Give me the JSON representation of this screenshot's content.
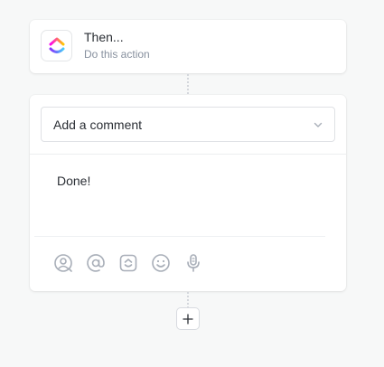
{
  "trigger": {
    "title": "Then...",
    "subtitle": "Do this action",
    "logo_icon": "clickup-logo-icon"
  },
  "action": {
    "select_value": "Add a comment",
    "comment_text": "Done!",
    "toolbar_icons": [
      "assign-icon",
      "mention-icon",
      "emoji-box-icon",
      "smiley-icon",
      "microphone-icon"
    ]
  },
  "add_step_icon": "plus-icon",
  "colors": {
    "background": "#f7f8f8",
    "card": "#ffffff",
    "text": "#2a2e34",
    "muted": "#87909e",
    "icon": "#a8aeb8"
  }
}
